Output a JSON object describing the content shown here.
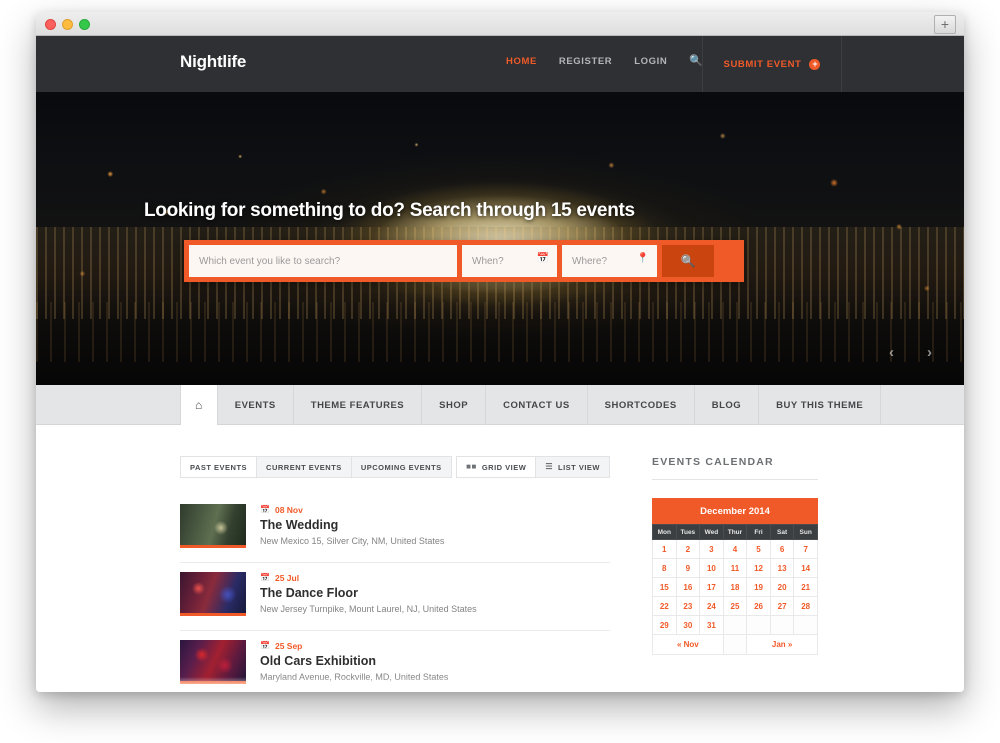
{
  "browser": {
    "new_tab_label": "+",
    "traffic_lights": [
      "close-red",
      "minimize-yellow",
      "maximize-green"
    ]
  },
  "header": {
    "brand": "Nightlife",
    "nav": [
      {
        "label": "HOME",
        "active": true
      },
      {
        "label": "REGISTER",
        "active": false
      },
      {
        "label": "LOGIN",
        "active": false
      }
    ],
    "search_icon": "search-icon",
    "submit_event": {
      "label": "SUBMIT EVENT",
      "plus": "+"
    }
  },
  "hero": {
    "title": "Looking for something to do? Search through 15 events",
    "event_count": "15",
    "search": {
      "keyword_placeholder": "Which event you like to search?",
      "keyword_value": "",
      "when_placeholder": "When?",
      "when_value": "",
      "when_icon": "calendar-icon",
      "where_placeholder": "Where?",
      "where_value": "",
      "where_icon": "map-pin-icon",
      "submit_icon": "search-icon"
    },
    "prev_arrow": "‹",
    "next_arrow": "›"
  },
  "secondary_nav": {
    "home_icon": "⌂",
    "items": [
      {
        "label": "EVENTS"
      },
      {
        "label": "THEME FEATURES"
      },
      {
        "label": "SHOP"
      },
      {
        "label": "CONTACT US"
      },
      {
        "label": "SHORTCODES"
      },
      {
        "label": "BLOG"
      },
      {
        "label": "BUY THIS THEME"
      }
    ]
  },
  "events_panel": {
    "filter_tabs": [
      {
        "label": "PAST EVENTS",
        "active": true
      },
      {
        "label": "CURRENT EVENTS",
        "active": false
      },
      {
        "label": "UPCOMING EVENTS",
        "active": false
      }
    ],
    "view_buttons": [
      {
        "label": "GRID VIEW",
        "icon": "grid-icon",
        "active": true
      },
      {
        "label": "LIST VIEW",
        "icon": "list-icon",
        "active": false
      }
    ],
    "events": [
      {
        "date": "08 Nov",
        "title": "The Wedding",
        "location": "New Mexico 15, Silver City, NM, United States",
        "thumb_class": "thumb-wedding"
      },
      {
        "date": "25 Jul",
        "title": "The Dance Floor",
        "location": "New Jersey Turnpike, Mount Laurel, NJ, United States",
        "thumb_class": "thumb-dance"
      },
      {
        "date": "25 Sep",
        "title": "Old Cars Exhibition",
        "location": "Maryland Avenue, Rockville, MD, United States",
        "thumb_class": "thumb-cars"
      }
    ]
  },
  "sidebar": {
    "title": "EVENTS CALENDAR",
    "calendar": {
      "month_label": "December 2014",
      "weekdays": [
        "Mon",
        "Tues",
        "Wed",
        "Thur",
        "Fri",
        "Sat",
        "Sun"
      ],
      "weeks": [
        [
          "1",
          "2",
          "3",
          "4",
          "5",
          "6",
          "7"
        ],
        [
          "8",
          "9",
          "10",
          "11",
          "12",
          "13",
          "14"
        ],
        [
          "15",
          "16",
          "17",
          "18",
          "19",
          "20",
          "21"
        ],
        [
          "22",
          "23",
          "24",
          "25",
          "26",
          "27",
          "28"
        ],
        [
          "29",
          "30",
          "31",
          "",
          "",
          "",
          ""
        ]
      ],
      "prev_label": "« Nov",
      "next_label": "Jan »"
    }
  },
  "colors": {
    "accent": "#f05a28",
    "accent_dark": "#c9440f",
    "header_bg": "#2f3033",
    "secondary_nav_bg": "#e3e5e7",
    "calendar_weekday_bg": "#3c3f42"
  }
}
